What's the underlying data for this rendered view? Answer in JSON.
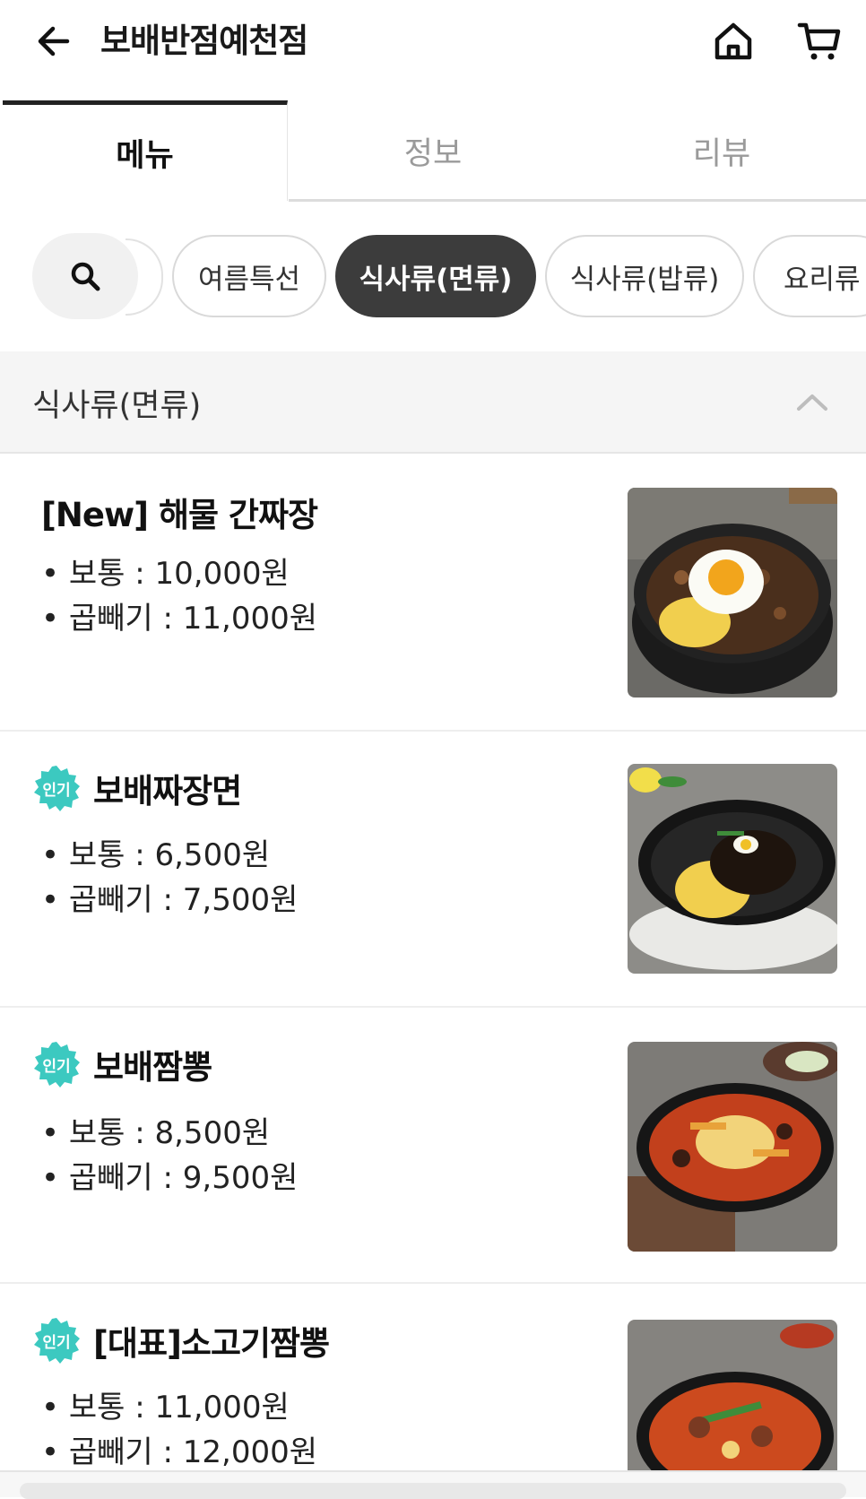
{
  "header": {
    "title": "보배반점예천점",
    "back_icon": "arrow-left-icon",
    "home_icon": "home-icon",
    "cart_icon": "cart-icon"
  },
  "tabs": [
    {
      "label": "메뉴",
      "active": true
    },
    {
      "label": "정보",
      "active": false
    },
    {
      "label": "리뷰",
      "active": false
    }
  ],
  "categories": [
    {
      "label": "여름특선",
      "active": false
    },
    {
      "label": "식사류(면류)",
      "active": true
    },
    {
      "label": "식사류(밥류)",
      "active": false
    },
    {
      "label": "요리류",
      "active": false
    }
  ],
  "section": {
    "title": "식사류(면류)"
  },
  "items": [
    {
      "name": "[New] 해물 간짜장",
      "badge": "",
      "prices": [
        "• 보통 : 10,000원",
        "• 곱빼기 : 11,000원"
      ]
    },
    {
      "name": "보배짜장면",
      "badge": "인기",
      "prices": [
        "• 보통 : 6,500원",
        "• 곱빼기 : 7,500원"
      ]
    },
    {
      "name": "보배짬뽕",
      "badge": "인기",
      "prices": [
        "• 보통 : 8,500원",
        "• 곱빼기 : 9,500원"
      ]
    },
    {
      "name": "[대표]소고기짬뽕",
      "badge": "인기",
      "prices": [
        "• 보통 : 11,000원",
        "• 곱빼기 : 12,000원"
      ]
    }
  ],
  "colors": {
    "badge": "#3cc9c0",
    "active_chip": "#3c3c3c",
    "section_bg": "#f5f5f5"
  }
}
